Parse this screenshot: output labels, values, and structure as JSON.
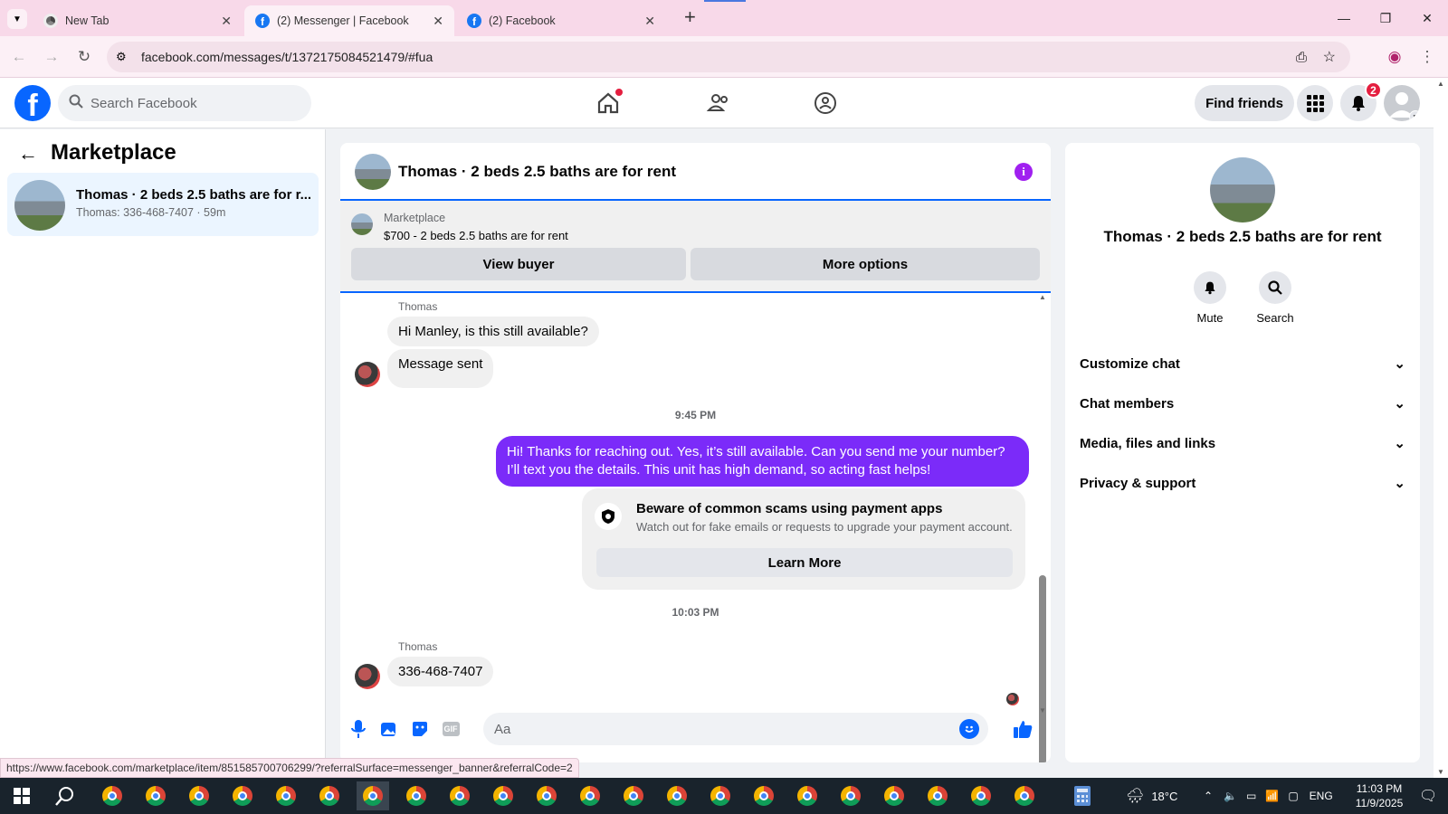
{
  "browser": {
    "tabs": [
      {
        "title": "New Tab",
        "active": false
      },
      {
        "title": "(2) Messenger | Facebook",
        "active": true
      },
      {
        "title": "(2) Facebook",
        "active": false
      }
    ],
    "new_tab_label": "+",
    "url": "facebook.com/messages/t/1372175084521479/#fua",
    "status_url": "https://www.facebook.com/marketplace/item/851585700706299/?referralSurface=messenger_banner&referralCode=2"
  },
  "fb_header": {
    "logo": "f",
    "search_placeholder": "Search Facebook",
    "find_friends": "Find friends",
    "notifications_count": "2"
  },
  "left_pane": {
    "title": "Marketplace",
    "conversation": {
      "title": "Thomas · 2 beds 2.5 baths are for r...",
      "subtitle": "Thomas: 336-468-7407 · 59m"
    }
  },
  "chat": {
    "title": "Thomas · 2 beds 2.5 baths are for rent",
    "banner": {
      "label": "Marketplace",
      "listing": "$700 - 2 beds 2.5 baths are for rent",
      "view_buyer": "View buyer",
      "more_options": "More options"
    },
    "messages": {
      "sender1": "Thomas",
      "msg1": "Hi Manley, is this still available?",
      "msg2": "Message sent",
      "time1": "9:45 PM",
      "outgoing": "Hi! Thanks for reaching out. Yes, it’s still available. Can you send me your number? I’ll text you the details. This unit has high demand, so acting fast helps!",
      "scam_title": "Beware of common scams using payment apps",
      "scam_body": "Watch out for fake emails or requests to upgrade your payment account.",
      "learn_more": "Learn More",
      "time2": "10:03 PM",
      "sender2": "Thomas",
      "msg3": "336-468-7407"
    },
    "composer_placeholder": "Aa"
  },
  "right_pane": {
    "title": "Thomas · 2 beds 2.5 baths are for rent",
    "mute": "Mute",
    "search": "Search",
    "sections": [
      "Customize chat",
      "Chat members",
      "Media, files and links",
      "Privacy & support"
    ]
  },
  "taskbar": {
    "weather": "18°C",
    "lang": "ENG",
    "time": "11:03 PM",
    "date": "11/9/2025"
  },
  "colors": {
    "fb_blue": "#0866ff",
    "outgoing_bubble": "#7b2bf9",
    "badge_red": "#e41e3f"
  }
}
